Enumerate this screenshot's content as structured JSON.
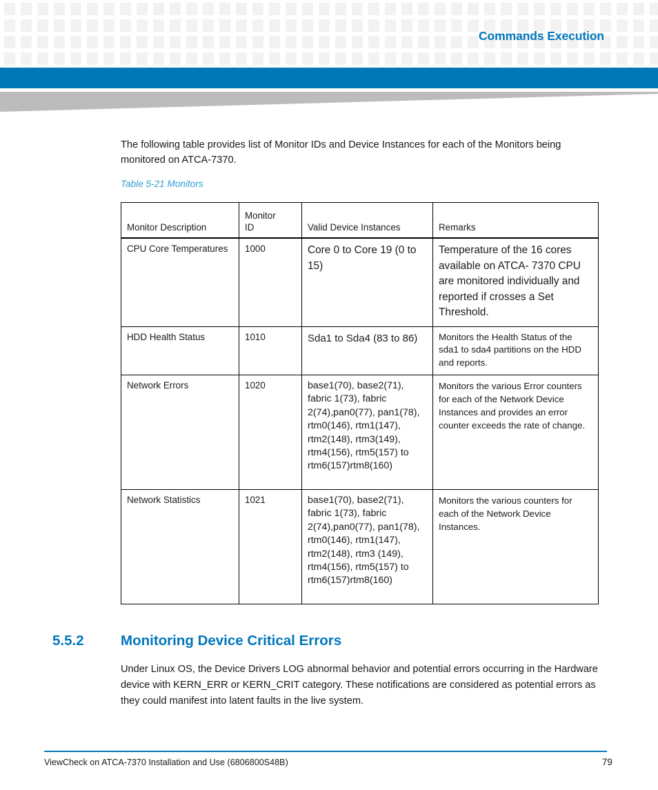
{
  "header": {
    "title": "Commands Execution",
    "accent_blue": "#0078b6",
    "title_blue": "#0076bc",
    "square_gray": "#f2f2f2",
    "wedge_gray": "#bcbcbc"
  },
  "intro": {
    "paragraph": "The following table provides list of Monitor IDs and Device Instances for each of the Monitors being monitored on ATCA-7370."
  },
  "table": {
    "caption": "Table 5-21 Monitors",
    "caption_color": "#2e9fd4",
    "columns": [
      "Monitor Description",
      "Monitor ID",
      "Valid Device Instances",
      "Remarks"
    ],
    "columns_display": {
      "monitor_description": "Monitor Description",
      "monitor_id_line1": "Monitor",
      "monitor_id_line2": "ID",
      "valid_device_instances": "Valid Device Instances",
      "remarks": "Remarks"
    },
    "rows": [
      {
        "description": "CPU Core Temperatures",
        "monitor_id": "1000",
        "valid_device_instances": "Core 0 to Core 19 (0 to 15)",
        "remarks": "Temperature of the 16 cores available on ATCA- 7370 CPU are monitored individually and reported if crosses a Set Threshold."
      },
      {
        "description": "HDD Health Status",
        "monitor_id": "1010",
        "valid_device_instances": "Sda1 to Sda4 (83 to 86)",
        "remarks": "Monitors the Health Status of the sda1 to sda4 partitions on the HDD and reports."
      },
      {
        "description": "Network Errors",
        "monitor_id": "1020",
        "valid_device_instances": "base1(70), base2(71), fabric 1(73), fabric 2(74),pan0(77), pan1(78), rtm0(146), rtm1(147), rtm2(148), rtm3(149), rtm4(156), rtm5(157) to rtm6(157)rtm8(160)",
        "remarks": "Monitors the various Error counters for each of the Network Device Instances and provides an error counter exceeds the rate of change."
      },
      {
        "description": "Network Statistics",
        "monitor_id": "1021",
        "valid_device_instances": "base1(70), base2(71), fabric 1(73), fabric 2(74),pan0(77), pan1(78), rtm0(146), rtm1(147), rtm2(148), rtm3 (149), rtm4(156), rtm5(157) to rtm6(157)rtm8(160)",
        "remarks": "Monitors the various counters for each of the Network Device Instances."
      }
    ]
  },
  "section": {
    "number": "5.5.2",
    "title": "Monitoring Device Critical Errors",
    "paragraph": "Under Linux OS, the Device Drivers LOG abnormal behavior and potential errors occurring in the Hardware device with KERN_ERR or KERN_CRIT category. These notifications are considered as potential errors as they could manifest into latent faults in the live system."
  },
  "footer": {
    "document": "ViewCheck on ATCA-7370 Installation and Use (6806800S48B)",
    "page_number": "79",
    "rule_color": "#0078b6"
  }
}
